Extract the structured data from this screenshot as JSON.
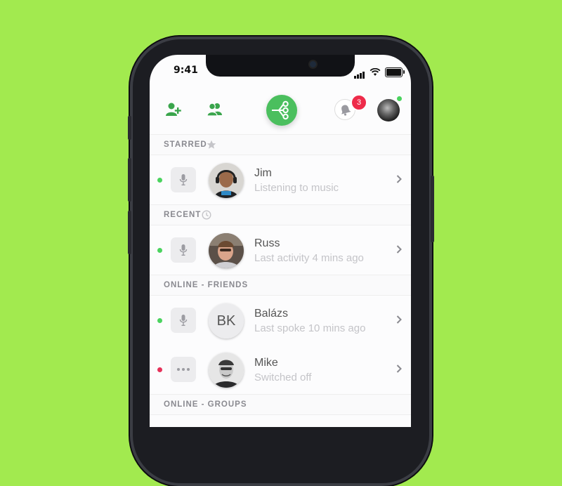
{
  "status_bar": {
    "time": "9:41"
  },
  "header": {
    "add_friend_icon": "add-user-icon",
    "group_icon": "users-icon",
    "center_icon": "share-network-icon",
    "notifications_count": "3",
    "profile_online": true
  },
  "sections": [
    {
      "title": "STARRED",
      "icon": "star-icon"
    },
    {
      "title": "RECENT",
      "icon": "clock-icon"
    },
    {
      "title": "ONLINE - FRIENDS"
    },
    {
      "title": "ONLINE - GROUPS"
    }
  ],
  "contacts": [
    {
      "name": "Jim",
      "status": "Listening to music",
      "presence": "online",
      "action": "mic-icon"
    },
    {
      "name": "Russ",
      "status": "Last activity 4 mins ago",
      "presence": "online",
      "action": "mic-icon"
    },
    {
      "name": "Balázs",
      "initials": "BK",
      "status": "Last spoke 10 mins ago",
      "presence": "online",
      "action": "mic-icon"
    },
    {
      "name": "Mike",
      "status": "Switched off",
      "presence": "offline",
      "action": "more-icon"
    }
  ],
  "colors": {
    "background": "#a2ea4f",
    "accent": "#4bbf5e",
    "online": "#4bd35f",
    "offline": "#e6325a",
    "badge": "#ee2b4a"
  }
}
